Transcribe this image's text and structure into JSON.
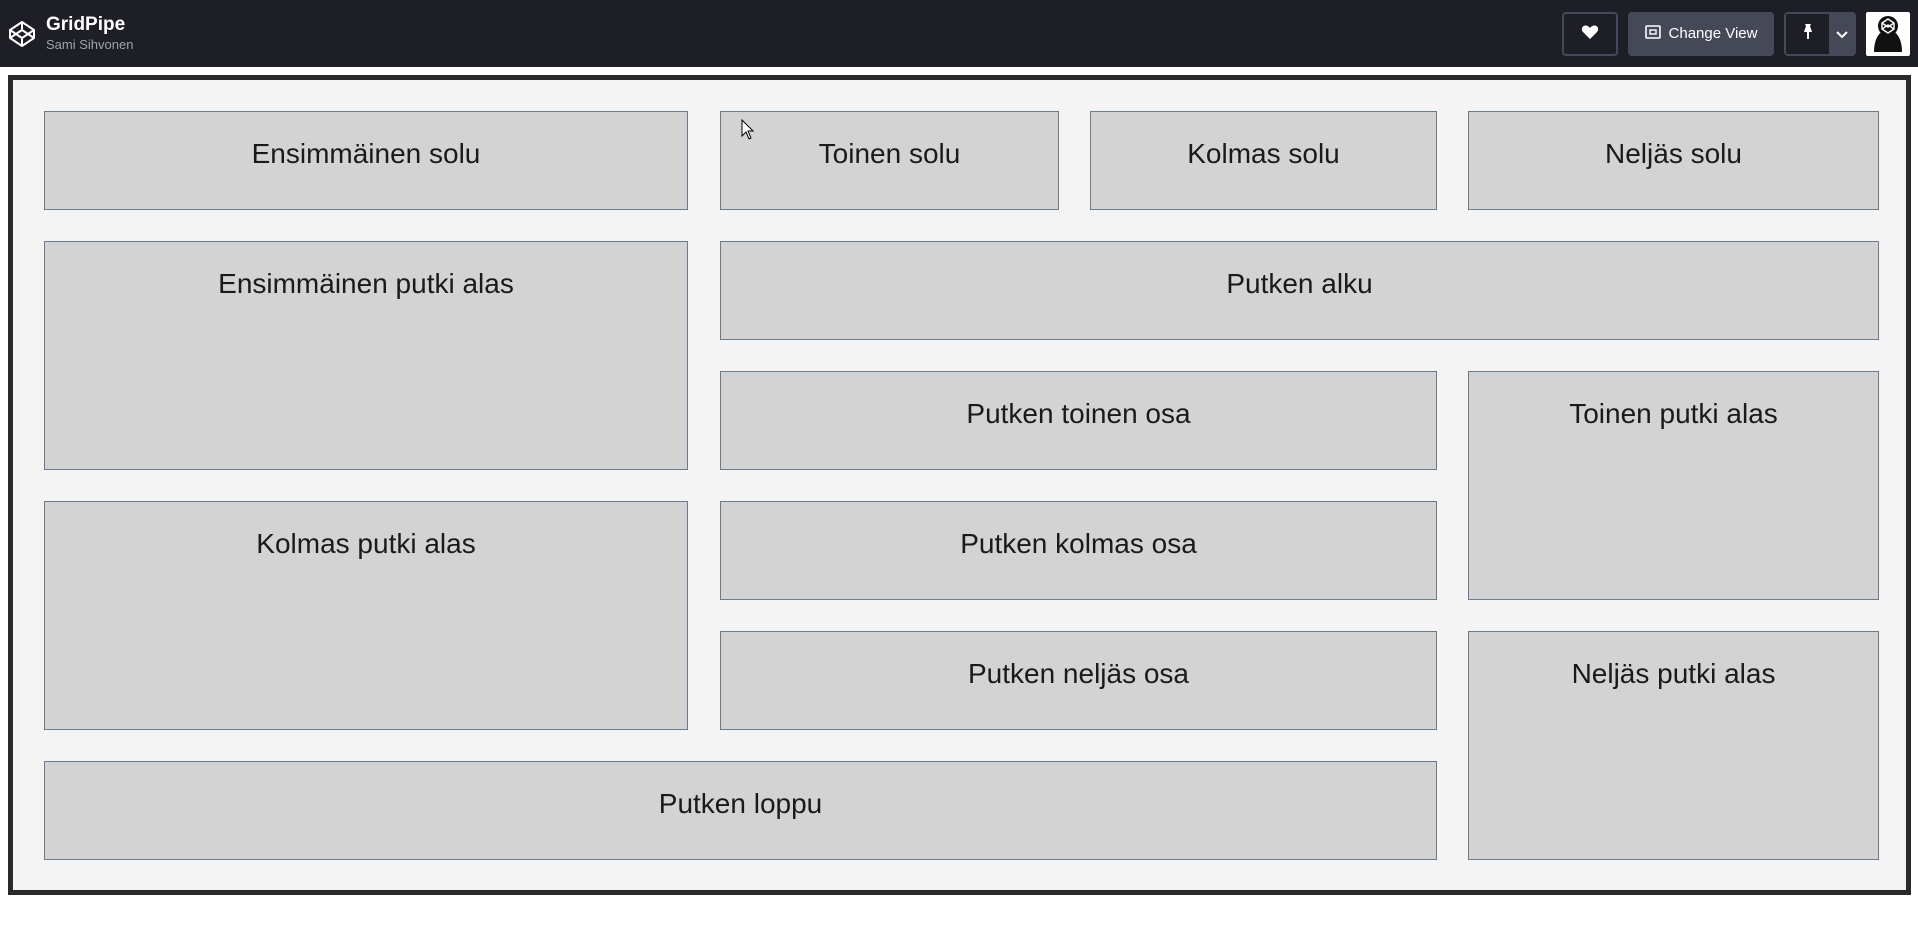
{
  "header": {
    "title": "GridPipe",
    "author": "Sami Sihvonen",
    "logo_icon": "codepen-logo-icon",
    "heart_icon": "heart-icon",
    "change_view_label": "Change View",
    "change_view_icon": "layout-icon",
    "pin_icon": "pin-icon",
    "caret_icon": "chevron-down-icon",
    "avatar_icon": "avatar-icon"
  },
  "cells": {
    "c1": "Ensimmäinen solu",
    "c2": "Toinen solu",
    "c3": "Kolmas solu",
    "c4": "Neljäs solu",
    "c5": "Ensimmäinen putki alas",
    "c6": "Putken alku",
    "c7": "Putken toinen osa",
    "c8": "Toinen putki alas",
    "c9": "Kolmas putki alas",
    "c10": "Putken kolmas osa",
    "c11": "Putken neljäs osa",
    "c12": "Neljäs putki alas",
    "c13": "Putken loppu"
  },
  "colors": {
    "topbar_bg": "#1e1f26",
    "cell_bg": "#d3d3d3",
    "cell_border": "#6b7a8f",
    "stage_bg": "#f4f4f4"
  }
}
